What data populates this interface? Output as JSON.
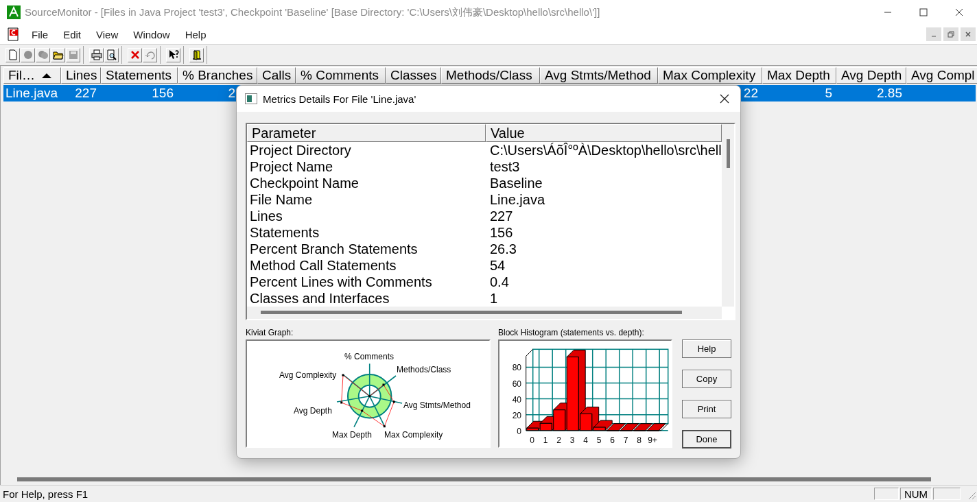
{
  "window": {
    "title": "SourceMonitor - [Files in Java Project 'test3', Checkpoint 'Baseline'  [Base Directory: 'C:\\Users\\刘伟豪\\Desktop\\hello\\src\\hello\\']]"
  },
  "menu": [
    "File",
    "Edit",
    "View",
    "Window",
    "Help"
  ],
  "table": {
    "columns": [
      {
        "label": "Fil…",
        "sorted": true
      },
      {
        "label": "Lines",
        "sorted": false
      },
      {
        "label": "Statements",
        "sorted": false
      },
      {
        "label": "% Branches",
        "sorted": false
      },
      {
        "label": "Calls",
        "sorted": false
      },
      {
        "label": "% Comments",
        "sorted": false
      },
      {
        "label": "Classes",
        "sorted": false
      },
      {
        "label": "Methods/Class",
        "sorted": false
      },
      {
        "label": "Avg Stmts/Method",
        "sorted": false
      },
      {
        "label": "Max Complexity",
        "sorted": false
      },
      {
        "label": "Max Depth",
        "sorted": false
      },
      {
        "label": "Avg Depth",
        "sorted": false
      },
      {
        "label": "Avg Compl",
        "sorted": false
      }
    ],
    "rows": [
      {
        "selected": true,
        "cells": [
          "Line.java",
          "227",
          "156",
          "2",
          null,
          null,
          null,
          null,
          null,
          "22",
          "5",
          "2.85",
          null
        ]
      }
    ]
  },
  "dialog": {
    "title": "Metrics Details For File 'Line.java'",
    "columns": [
      "Parameter",
      "Value"
    ],
    "rows": [
      {
        "parameter": "Project Directory",
        "value": "C:\\Users\\ÁõÎ°ºÀ\\Desktop\\hello\\src\\hell"
      },
      {
        "parameter": "Project Name",
        "value": "test3"
      },
      {
        "parameter": "Checkpoint Name",
        "value": "Baseline"
      },
      {
        "parameter": "File Name",
        "value": "Line.java"
      },
      {
        "parameter": "Lines",
        "value": "227"
      },
      {
        "parameter": "Statements",
        "value": "156"
      },
      {
        "parameter": "Percent Branch Statements",
        "value": "26.3"
      },
      {
        "parameter": "Method Call Statements",
        "value": "54"
      },
      {
        "parameter": "Percent Lines with Comments",
        "value": "0.4"
      },
      {
        "parameter": "Classes and Interfaces",
        "value": "1"
      }
    ],
    "kiviat": {
      "label": "Kiviat Graph:",
      "axes": [
        "% Comments",
        "Methods/Class",
        "Avg Complexity",
        "Avg Stmts/Method",
        "Avg Depth",
        "Max Depth",
        "Max Complexity"
      ]
    },
    "histogram": {
      "label": "Block Histogram (statements vs. depth):",
      "chart_data": {
        "type": "bar",
        "categories": [
          "0",
          "1",
          "2",
          "3",
          "4",
          "5",
          "6",
          "7",
          "8",
          "9+"
        ],
        "values": [
          3,
          9,
          26,
          93,
          21,
          4,
          0,
          0,
          0,
          0
        ],
        "ylim": [
          0,
          94
        ],
        "yticks": [
          0,
          20,
          40,
          60,
          80
        ],
        "grid": true
      }
    },
    "buttons": [
      {
        "label": "Help",
        "default": false
      },
      {
        "label": "Copy",
        "default": false
      },
      {
        "label": "Print",
        "default": false
      },
      {
        "label": "Done",
        "default": true
      }
    ]
  },
  "status_bar": {
    "text": "For Help, press F1",
    "indicator": "NUM"
  }
}
